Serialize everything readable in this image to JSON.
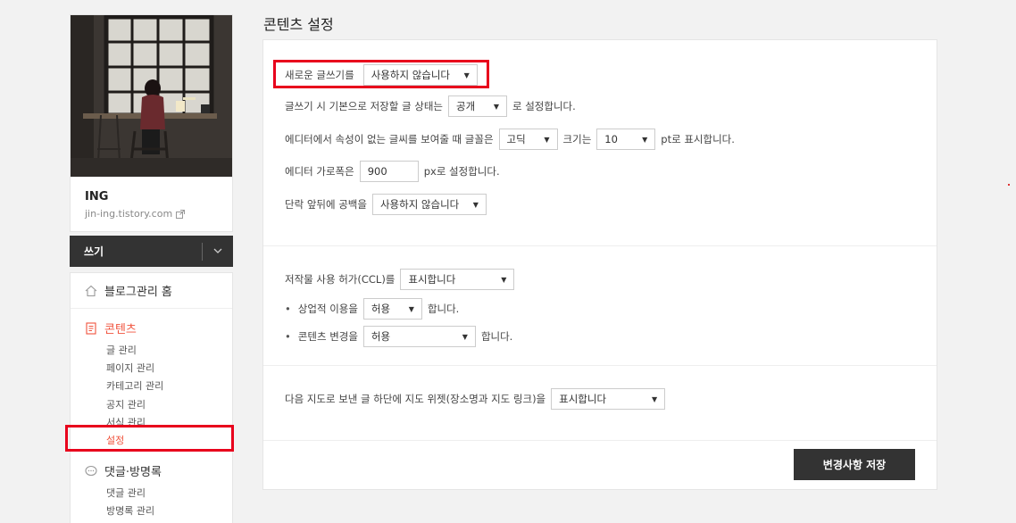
{
  "profile": {
    "name": "ING",
    "url": "jin-ing.tistory.com"
  },
  "write_bar": {
    "label": "쓰기",
    "toggle_icon": "chevron-down-icon"
  },
  "nav": {
    "home_label": "블로그관리 홈",
    "contents": {
      "title": "콘텐츠",
      "items": [
        "글 관리",
        "페이지 관리",
        "카테고리 관리",
        "공지 관리",
        "서식 관리",
        "설정"
      ],
      "active_index": 5
    },
    "comments": {
      "title": "댓글·방명록",
      "items": [
        "댓글 관리",
        "방명록 관리"
      ]
    }
  },
  "colors": {
    "accent": "#f0533d",
    "highlight": "#e8001c",
    "dark": "#333333"
  },
  "main": {
    "title": "콘텐츠 설정",
    "section1": {
      "new_editor": {
        "label": "새로운 글쓰기를",
        "value": "사용하지 않습니다"
      },
      "default_status": {
        "label": "글쓰기 시 기본으로 저장할 글 상태는",
        "value": "공개",
        "suffix": "로 설정합니다."
      },
      "font": {
        "label": "에디터에서 속성이 없는 글씨를 보여줄 때 글꼴은",
        "font_value": "고딕",
        "size_label": "크기는",
        "size_value": "10",
        "suffix": "pt로 표시합니다."
      },
      "width": {
        "label": "에디터 가로폭은",
        "value": "900",
        "suffix": "px로 설정합니다."
      },
      "paragraph": {
        "label": "단락 앞뒤에 공백을",
        "value": "사용하지 않습니다"
      }
    },
    "section2": {
      "ccl": {
        "label": "저작물 사용 허가(CCL)를",
        "value": "표시합니다"
      },
      "commercial": {
        "label": "상업적 이용을",
        "value": "허용",
        "suffix": "합니다."
      },
      "modify": {
        "label": "콘텐츠 변경을",
        "value": "허용",
        "suffix": "합니다."
      }
    },
    "section3": {
      "map": {
        "label": "다음 지도로 보낸 글 하단에 지도 위젯(장소명과 지도 링크)을",
        "value": "표시합니다"
      }
    },
    "save_label": "변경사항 저장"
  }
}
